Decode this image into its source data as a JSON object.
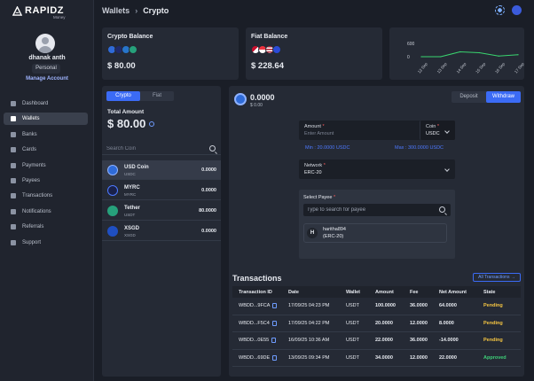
{
  "brand": {
    "name": "RAPIDZ",
    "sub": "Money"
  },
  "user": {
    "name": "dhanak anth",
    "role": "Personal",
    "manage_label": "Manage Account"
  },
  "nav": [
    {
      "label": "Dashboard",
      "icon": "dashboard-icon"
    },
    {
      "label": "Wallets",
      "icon": "wallet-icon"
    },
    {
      "label": "Banks",
      "icon": "bank-icon"
    },
    {
      "label": "Cards",
      "icon": "card-icon"
    },
    {
      "label": "Payments",
      "icon": "payments-icon"
    },
    {
      "label": "Payees",
      "icon": "payees-icon"
    },
    {
      "label": "Transactions",
      "icon": "transactions-icon"
    },
    {
      "label": "Notifications",
      "icon": "bell-icon"
    },
    {
      "label": "Referrals",
      "icon": "referrals-icon"
    },
    {
      "label": "Support",
      "icon": "support-icon"
    }
  ],
  "breadcrumb": {
    "parent": "Wallets",
    "current": "Crypto"
  },
  "crypto_balance": {
    "title": "Crypto Balance",
    "amount": "$ 80.00"
  },
  "fiat_balance": {
    "title": "Fiat Balance",
    "amount": "$ 228.64"
  },
  "chart_data": {
    "type": "line",
    "x": [
      "12 Sep",
      "13 Sep",
      "14 Sep",
      "15 Sep",
      "16 Sep",
      "17 Sep"
    ],
    "series": [
      {
        "values": [
          0,
          0,
          220,
          180,
          30,
          90
        ]
      }
    ],
    "yticks": [
      "600",
      "0"
    ],
    "ylim": [
      -50,
      650
    ],
    "grid": false
  },
  "balance_panel": {
    "tabs": [
      "Crypto",
      "Fiat"
    ],
    "total_label": "Total Amount",
    "total_amount": "$ 80.00",
    "search_placeholder": "Search Coin",
    "coins": [
      {
        "name": "USD Coin",
        "symbol": "USDC",
        "amount": "0.0000",
        "icon": "usdc-icon"
      },
      {
        "name": "MYRC",
        "symbol": "MYRC",
        "amount": "0.0000",
        "icon": "myrc-icon"
      },
      {
        "name": "Tether",
        "symbol": "USDT",
        "amount": "80.0000",
        "icon": "tether-icon"
      },
      {
        "name": "XSGD",
        "symbol": "XSGD",
        "amount": "0.0000",
        "icon": "xsgd-icon"
      }
    ]
  },
  "main": {
    "amount": "0.0000",
    "sub_value": "$ 0.00",
    "actions": [
      "Deposit",
      "Withdraw"
    ],
    "amount_field": {
      "label": "Amount",
      "placeholder": "Enter Amount"
    },
    "coin_field": {
      "label": "Coin",
      "value": "USDC"
    },
    "min_label": "Min : 20.0000  USDC",
    "max_label": "Max : 300.0000  USDC",
    "network_field": {
      "label": "Network",
      "value": "ERC-20"
    },
    "payee": {
      "label": "Select Payee",
      "placeholder": "Type to search for payee",
      "item": {
        "initial": "H",
        "name": "haritha894",
        "network": "(ERC-20)"
      }
    }
  },
  "transactions": {
    "title": "Transactions",
    "view_all": "All Transactions →",
    "columns": [
      "Transaction ID",
      "Date",
      "Wallet",
      "Amount",
      "Fee",
      "Net Amount",
      "State"
    ],
    "rows": [
      {
        "id": "WBDD...9FCA",
        "date": "17/09/25 04:23 PM",
        "wallet": "USDT",
        "amount": "100.0000",
        "fee": "36.0000",
        "net": "64.0000",
        "state": "Pending"
      },
      {
        "id": "WBDD...F5C4",
        "date": "17/09/25 04:22 PM",
        "wallet": "USDT",
        "amount": "20.0000",
        "fee": "12.0000",
        "net": "8.0000",
        "state": "Pending"
      },
      {
        "id": "WBDD...0E55",
        "date": "16/09/25 10:36 AM",
        "wallet": "USDT",
        "amount": "22.0000",
        "fee": "36.0000",
        "net": "-14.0000",
        "state": "Pending"
      },
      {
        "id": "WBDD...69DE",
        "date": "13/09/25 09:34 PM",
        "wallet": "USDT",
        "amount": "34.0000",
        "fee": "12.0000",
        "net": "22.0000",
        "state": "Approved"
      }
    ]
  },
  "colors": {
    "accent": "#3b6bf5",
    "pending": "#f5c542",
    "approved": "#3ecf78",
    "chart_line": "#39d46f"
  }
}
